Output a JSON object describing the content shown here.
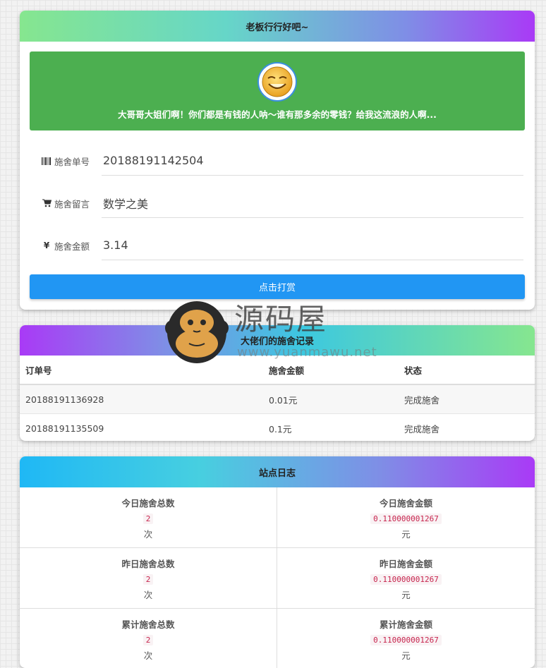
{
  "donate": {
    "title": "老板行行好吧~",
    "message": "大哥哥大姐们啊！你们都是有钱的人呐～谁有那多余的零钱？给我这流浪的人啊...",
    "fields": [
      {
        "icon": "barcode-icon",
        "label": "施舍单号",
        "value": "20188191142504"
      },
      {
        "icon": "cart-icon",
        "label": "施舍留言",
        "value": "数学之美"
      },
      {
        "icon": "yen-icon",
        "label": "施舍金额",
        "value": "3.14"
      }
    ],
    "submit_label": "点击打赏"
  },
  "records": {
    "title": "大佬们的施舍记录",
    "columns": [
      "订单号",
      "施舍金额",
      "状态"
    ],
    "rows": [
      {
        "order": "20188191136928",
        "amount": "0.01元",
        "status": "完成施舍"
      },
      {
        "order": "20188191135509",
        "amount": "0.1元",
        "status": "完成施舍"
      }
    ]
  },
  "stats": {
    "title": "站点日志",
    "items": [
      {
        "label": "今日施舍总数",
        "value": "2",
        "unit": "次"
      },
      {
        "label": "今日施舍金额",
        "value": "0.110000001267",
        "unit": "元"
      },
      {
        "label": "昨日施舍总数",
        "value": "2",
        "unit": "次"
      },
      {
        "label": "昨日施舍金额",
        "value": "0.110000001267",
        "unit": "元"
      },
      {
        "label": "累计施舍总数",
        "value": "2",
        "unit": "次"
      },
      {
        "label": "累计施舍金额",
        "value": "0.110000001267",
        "unit": "元"
      }
    ]
  },
  "watermark": {
    "name": "源码屋",
    "url": "www.yuanmawu.net"
  },
  "colors": {
    "hero": "#4caf50",
    "button": "#2196f3",
    "success": "#2e8b2e"
  }
}
